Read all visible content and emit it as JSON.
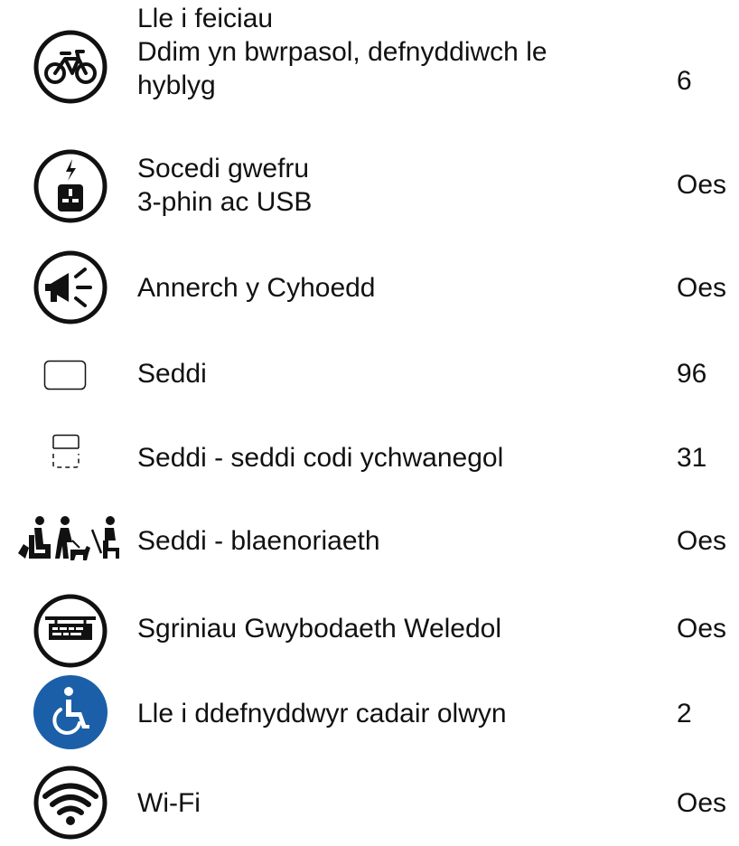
{
  "colors": {
    "text": "#111111",
    "icon_stroke": "#111111",
    "accessible_blue": "#1b5fa8"
  },
  "facilities": [
    {
      "icon": "bicycle-icon",
      "label_lines": [
        "Lle i feiciau",
        "Ddim yn bwrpasol, defnyddiwch le",
        "hyblyg"
      ],
      "value": "6"
    },
    {
      "icon": "charging-socket-icon",
      "label_lines": [
        "Socedi gwefru",
        "3-phin ac USB"
      ],
      "value": "Oes"
    },
    {
      "icon": "megaphone-icon",
      "label_lines": [
        "Annerch y Cyhoedd"
      ],
      "value": "Oes"
    },
    {
      "icon": "seat-icon",
      "label_lines": [
        "Seddi"
      ],
      "value": "96"
    },
    {
      "icon": "tip-up-seat-icon",
      "label_lines": [
        "Seddi - seddi codi ychwanegol"
      ],
      "value": "31"
    },
    {
      "icon": "priority-seat-icon",
      "label_lines": [
        "Seddi - blaenoriaeth"
      ],
      "value": "Oes"
    },
    {
      "icon": "info-screen-icon",
      "label_lines": [
        "Sgriniau Gwybodaeth Weledol"
      ],
      "value": "Oes"
    },
    {
      "icon": "wheelchair-icon",
      "label_lines": [
        "Lle i ddefnyddwyr cadair olwyn"
      ],
      "value": "2"
    },
    {
      "icon": "wifi-icon",
      "label_lines": [
        "Wi-Fi"
      ],
      "value": "Oes"
    }
  ]
}
